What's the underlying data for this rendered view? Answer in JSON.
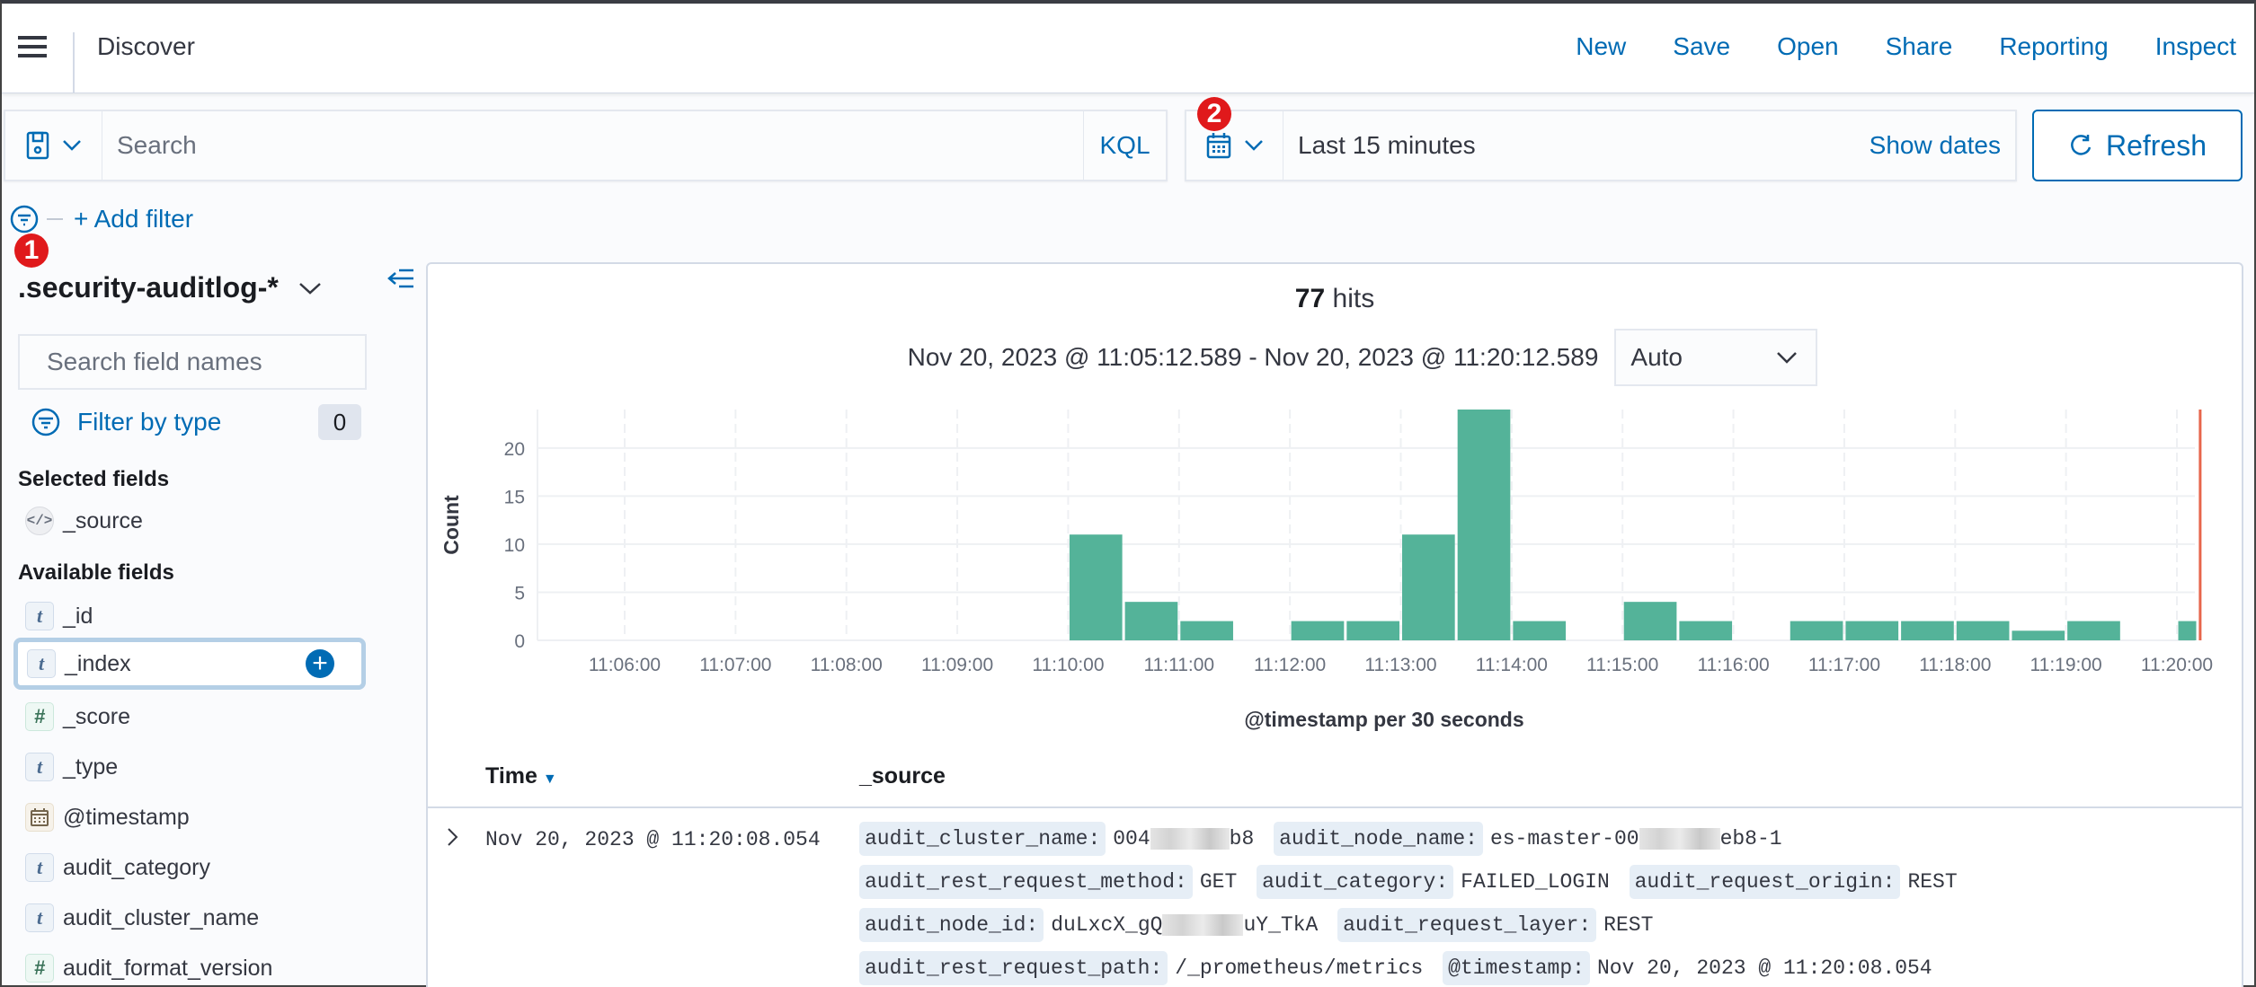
{
  "header": {
    "app_title": "Discover",
    "nav": [
      "New",
      "Save",
      "Open",
      "Share",
      "Reporting",
      "Inspect"
    ]
  },
  "query_bar": {
    "search_placeholder": "Search",
    "search_value": "",
    "language": "KQL"
  },
  "date_picker": {
    "value": "Last 15 minutes",
    "show_dates_label": "Show dates"
  },
  "refresh_label": "Refresh",
  "annotations": [
    "1",
    "2"
  ],
  "filter_bar": {
    "add_filter_label": "+ Add filter"
  },
  "sidebar": {
    "index_pattern": ".security-auditlog-*",
    "field_search_placeholder": "Search field names",
    "filter_by_type_label": "Filter by type",
    "filter_by_type_count": "0",
    "selected_fields_title": "Selected fields",
    "selected_fields": [
      {
        "name": "_source",
        "type": "source",
        "icon": "code-icon"
      }
    ],
    "available_fields_title": "Available fields",
    "available_fields": [
      {
        "name": "_id",
        "type": "string",
        "glyph": "t"
      },
      {
        "name": "_index",
        "type": "string",
        "glyph": "t",
        "highlighted": true
      },
      {
        "name": "_score",
        "type": "number",
        "glyph": "#"
      },
      {
        "name": "_type",
        "type": "string",
        "glyph": "t"
      },
      {
        "name": "@timestamp",
        "type": "date",
        "glyph": "calendar"
      },
      {
        "name": "audit_category",
        "type": "string",
        "glyph": "t"
      },
      {
        "name": "audit_cluster_name",
        "type": "string",
        "glyph": "t"
      },
      {
        "name": "audit_format_version",
        "type": "number",
        "glyph": "#"
      }
    ]
  },
  "results": {
    "hits_count": "77",
    "hits_label": "hits",
    "time_range": "Nov 20, 2023 @ 11:05:12.589 - Nov 20, 2023 @ 11:20:12.589",
    "interval": "Auto"
  },
  "chart_data": {
    "type": "bar",
    "title": "",
    "xlabel": "@timestamp per 30 seconds",
    "ylabel": "Count",
    "ylim": [
      0,
      24
    ],
    "y_ticks": [
      0,
      5,
      10,
      15,
      20
    ],
    "x_tick_labels": [
      "11:06:00",
      "11:07:00",
      "11:08:00",
      "11:09:00",
      "11:10:00",
      "11:11:00",
      "11:12:00",
      "11:13:00",
      "11:14:00",
      "11:15:00",
      "11:16:00",
      "11:17:00",
      "11:18:00",
      "11:19:00",
      "11:20:00"
    ],
    "grid": true,
    "bar_color": "#54b399",
    "now_marker": "11:20:12.589",
    "now_marker_color": "#e7664c",
    "categories": [
      "11:10:00",
      "11:10:30",
      "11:11:00",
      "11:11:30",
      "11:12:00",
      "11:12:30",
      "11:13:00",
      "11:13:30",
      "11:14:00",
      "11:14:30",
      "11:15:00",
      "11:15:30",
      "11:16:00",
      "11:16:30",
      "11:17:00",
      "11:17:30",
      "11:18:00",
      "11:18:30",
      "11:19:00",
      "11:19:30",
      "11:20:00"
    ],
    "values": [
      11,
      4,
      2,
      0,
      2,
      2,
      11,
      24,
      2,
      0,
      4,
      2,
      0,
      2,
      2,
      2,
      2,
      1,
      2,
      0,
      2
    ]
  },
  "table": {
    "columns": [
      "Time",
      "_source"
    ],
    "rows": [
      {
        "time": "Nov 20, 2023 @ 11:20:08.054",
        "source": [
          {
            "key": "audit_cluster_name:",
            "value_prefix": "004",
            "value_suffix": "b8",
            "redacted": true
          },
          {
            "key": "audit_node_name:",
            "value_prefix": "es-master-00",
            "value_suffix": "eb8-1",
            "redacted": true
          },
          {
            "key": "audit_rest_request_method:",
            "value": "GET"
          },
          {
            "key": "audit_category:",
            "value": "FAILED_LOGIN"
          },
          {
            "key": "audit_request_origin:",
            "value": "REST"
          },
          {
            "key": "audit_node_id:",
            "value_prefix": "duLxcX_gQ",
            "value_suffix": "uY_TkA",
            "redacted": true
          },
          {
            "key": "audit_request_layer:",
            "value": "REST"
          },
          {
            "key": "audit_rest_request_path:",
            "value": "/_prometheus/metrics"
          },
          {
            "key": "@timestamp:",
            "value": "Nov 20, 2023 @ 11:20:08.054"
          }
        ]
      }
    ]
  }
}
